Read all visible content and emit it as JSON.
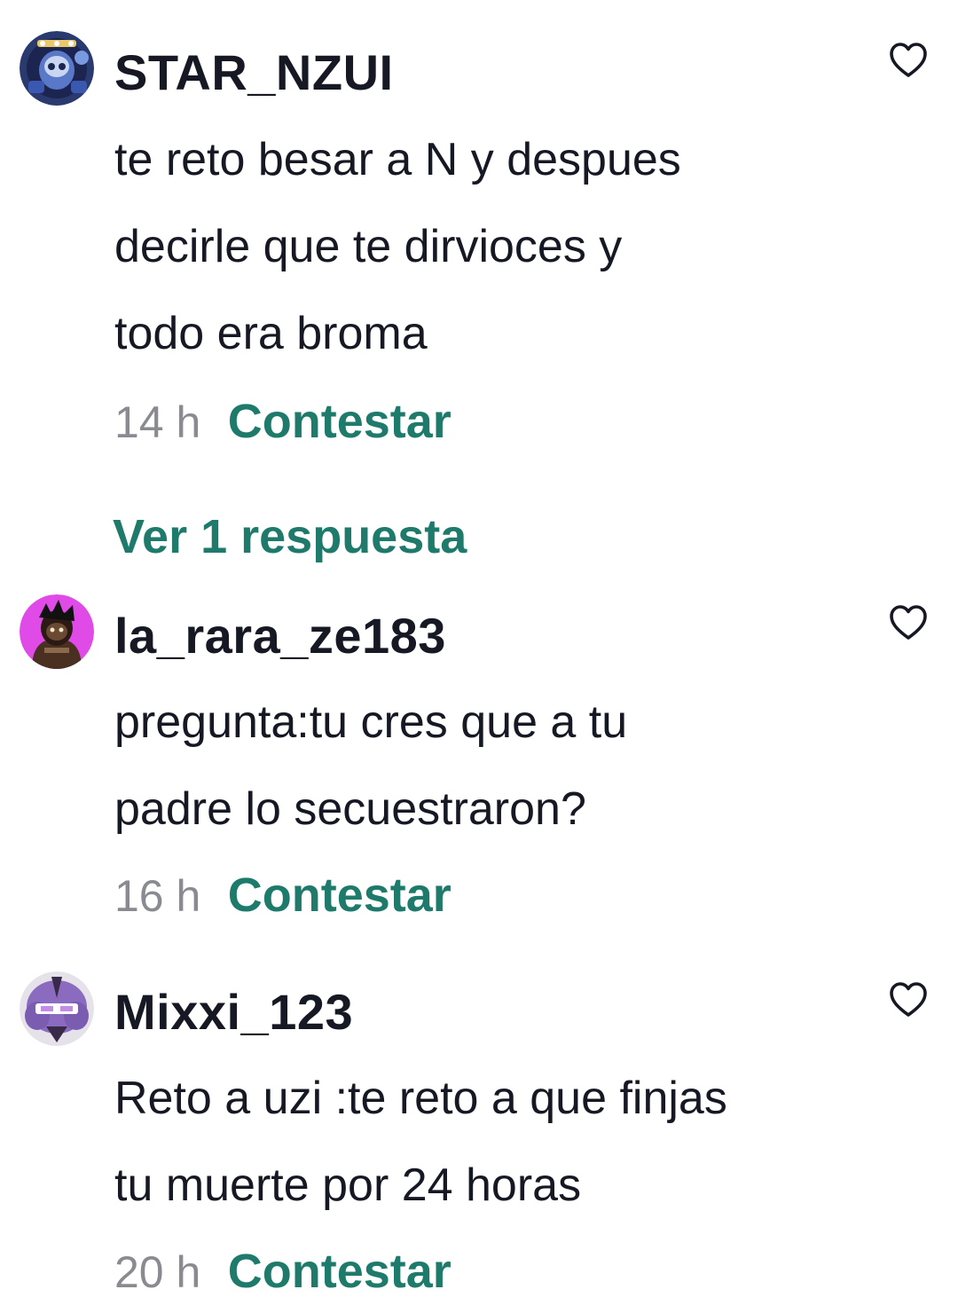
{
  "comments": [
    {
      "username": "STAR_NZUI",
      "lines": [
        "te reto besar a N  y despues",
        "decirle que te dirvioces y",
        "todo era broma"
      ],
      "time": "14 h",
      "reply_label": "Contestar",
      "avatar_icon": "robot-avatar-icon"
    },
    {
      "username": "la_rara_ze183",
      "lines": [
        "pregunta:tu cres que a tu",
        "padre lo secuestraron?"
      ],
      "time": "16 h",
      "reply_label": "Contestar",
      "avatar_icon": "character-avatar-icon"
    },
    {
      "username": "Mixxi_123",
      "lines": [
        "Reto a uzi :te reto a que finjas",
        "tu muerte por 24 horas"
      ],
      "time": "20 h",
      "reply_label": "Contestar",
      "avatar_icon": "purple-character-avatar-icon"
    }
  ],
  "view_replies_label": "Ver 1 respuesta",
  "colors": {
    "accent": "#1e7a6a",
    "muted": "#8a8b91",
    "text": "#161823"
  }
}
